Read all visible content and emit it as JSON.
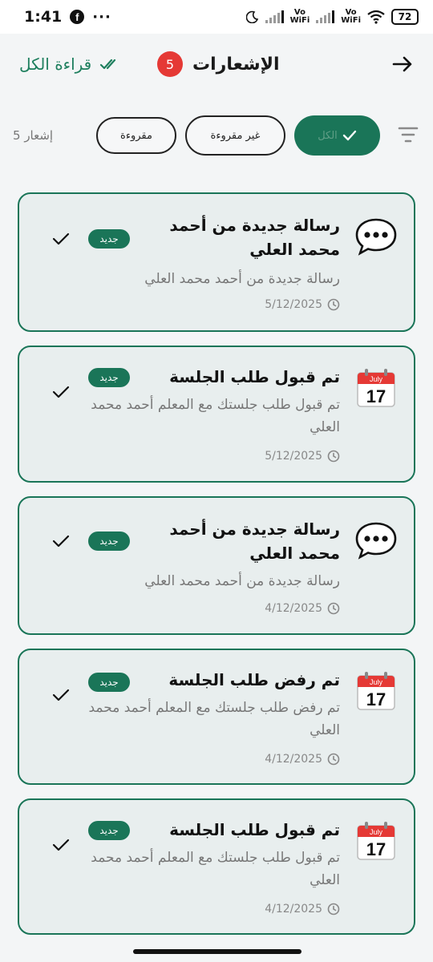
{
  "status_bar": {
    "time": "1:41",
    "dots": "···",
    "vo_top": "Vo",
    "vo_bottom": "WiFi",
    "battery": "72"
  },
  "header": {
    "title": "الإشعارات",
    "unread_count": "5",
    "read_all_label": "قراءة الكل"
  },
  "filters": {
    "count_label": "5 إشعار",
    "all_label": "الكل",
    "unread_label": "غير مقروءة",
    "read_label": "مقروءة",
    "selected": "all"
  },
  "colors": {
    "primary": "#1a7558",
    "badge_red": "#e53935",
    "card_bg": "#e8eeee"
  },
  "notifications": [
    {
      "icon": "speech-bubble-icon",
      "title": "رسالة جديدة من أحمد محمد العلي",
      "body": "رسالة جديدة من أحمد محمد العلي",
      "date": "5/12/2025",
      "badge": "جديد"
    },
    {
      "icon": "calendar-icon",
      "title": "تم قبول طلب الجلسة",
      "body": "تم قبول طلب جلستك مع المعلم أحمد محمد العلي",
      "date": "5/12/2025",
      "badge": "جديد"
    },
    {
      "icon": "speech-bubble-icon",
      "title": "رسالة جديدة من أحمد محمد العلي",
      "body": "رسالة جديدة من أحمد محمد العلي",
      "date": "4/12/2025",
      "badge": "جديد"
    },
    {
      "icon": "calendar-icon",
      "title": "تم رفض طلب الجلسة",
      "body": "تم رفض طلب جلستك مع المعلم أحمد محمد العلي",
      "date": "4/12/2025",
      "badge": "جديد"
    },
    {
      "icon": "calendar-icon",
      "title": "تم قبول طلب الجلسة",
      "body": "تم قبول طلب جلستك مع المعلم أحمد محمد العلي",
      "date": "4/12/2025",
      "badge": "جديد"
    }
  ],
  "calendar_icon": {
    "month": "July",
    "day": "17"
  }
}
